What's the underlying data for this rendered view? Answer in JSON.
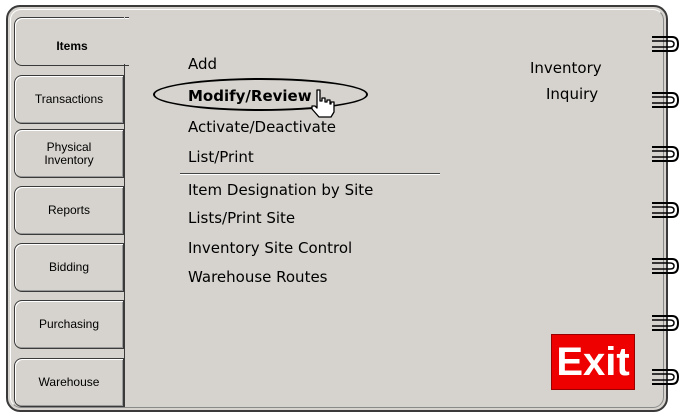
{
  "tabs": [
    {
      "label": "Items",
      "active": true
    },
    {
      "label": "Transactions",
      "active": false
    },
    {
      "label": "Physical Inventory",
      "active": false
    },
    {
      "label": "Reports",
      "active": false
    },
    {
      "label": "Bidding",
      "active": false
    },
    {
      "label": "Purchasing",
      "active": false
    },
    {
      "label": "Warehouse",
      "active": false
    }
  ],
  "menu": {
    "add": "Add",
    "modify_review": "Modify/Review",
    "activate_deactivate": "Activate/Deactivate",
    "list_print": "List/Print",
    "item_designation_by_site": "Item Designation by Site",
    "lists_print_site": "Lists/Print Site",
    "inventory_site_control": "Inventory Site Control",
    "warehouse_routes": "Warehouse Routes"
  },
  "side_title": {
    "line1": "Inventory",
    "line2": "Inquiry"
  },
  "exit_label": "Exit",
  "colors": {
    "panel": "#d6d3ce",
    "exit_bg": "#ee0000",
    "exit_text": "#ffffff"
  },
  "icons": [
    "binder-ring-icon",
    "hand-pointer-icon"
  ]
}
